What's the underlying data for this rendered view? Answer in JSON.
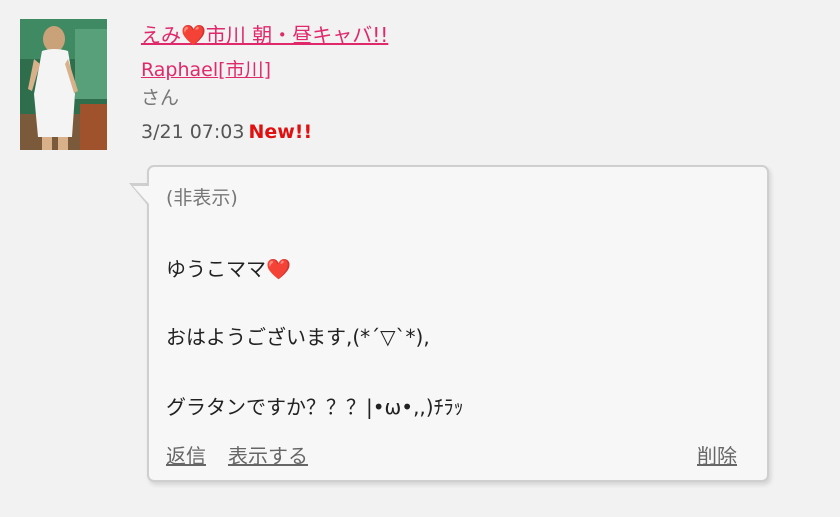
{
  "post": {
    "author_shop_link": "えみ❤️市川 朝・昼キャバ!!",
    "author_shop_name_prefix": "えみ",
    "author_heart": "❤️",
    "author_shop_name_suffix": "市川 朝・昼キャバ!!",
    "user_name": "Raphael",
    "user_area": "[市川]",
    "honorific": "さん",
    "timestamp": "3/21 07:03",
    "new_badge": "New!!"
  },
  "message": {
    "hidden_label": "(非表示)",
    "line1": "ゆうこママ❤️",
    "line2": "おはようございます,(*´▽`*),",
    "line3": "グラタンですか？？？|•ω•,,)ﾁﾗｯ"
  },
  "actions": {
    "reply": "返信",
    "show": "表示する",
    "delete": "削除"
  },
  "colors": {
    "link_pink": "#e0296b",
    "new_red": "#e01010",
    "background": "#f2f2f2",
    "bubble_bg": "#f7f7f7",
    "bubble_border": "#cfcfcf"
  }
}
